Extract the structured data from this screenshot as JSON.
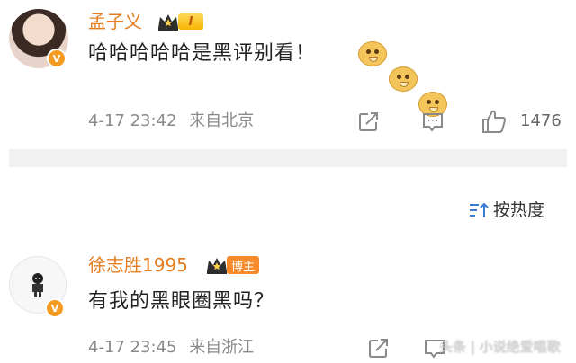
{
  "post1": {
    "username": "孟子义",
    "level_badge": "I",
    "text": "哈哈哈哈哈是黑评别看！",
    "emojis": [
      "doge-emoji",
      "doge-emoji",
      "doge-emoji"
    ],
    "timestamp": "4-17 23:42",
    "location": "来自北京",
    "like_count": "1476"
  },
  "sort": {
    "label": "按热度"
  },
  "post2": {
    "username": "徐志胜1995",
    "role_badge": "博主",
    "text": "有我的黑眼圈黑吗？",
    "timestamp": "4-17 23:45",
    "location": "来自浙江",
    "watermark": "头条 | 小说绝爱唱歌"
  },
  "colors": {
    "username": "#e57d1f",
    "verified_badge": "#f59b22",
    "divider": "#f1f1f1",
    "meta_text": "#8a8a8a"
  }
}
